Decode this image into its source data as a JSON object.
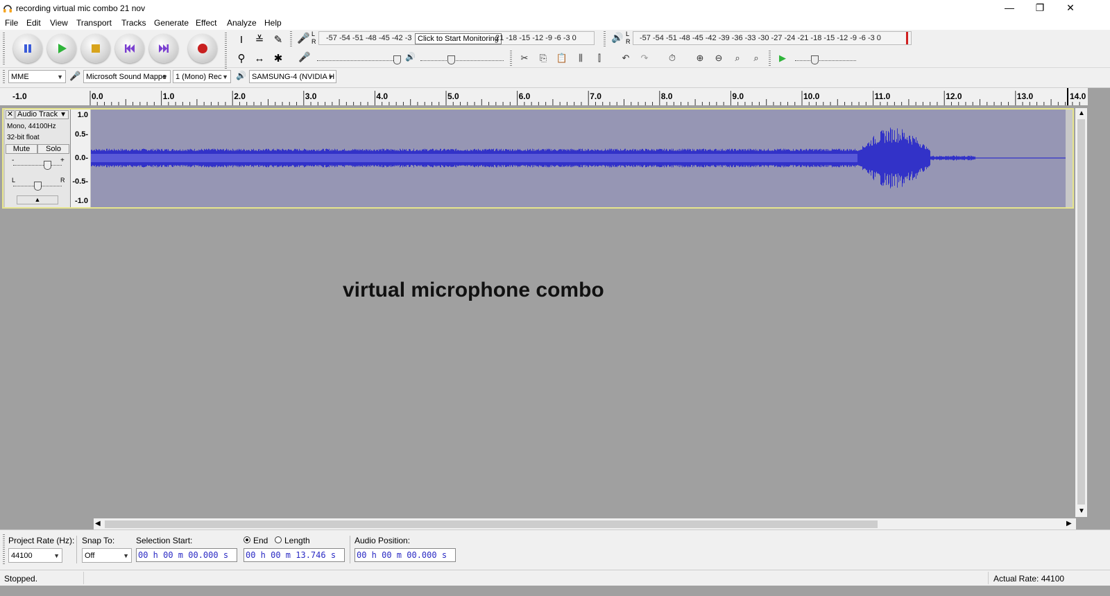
{
  "window": {
    "title": "recording virtual mic combo 21 nov",
    "minimize": "—",
    "maximize": "❐",
    "close": "✕"
  },
  "menu": [
    "File",
    "Edit",
    "View",
    "Transport",
    "Tracks",
    "Generate",
    "Effect",
    "Analyze",
    "Help"
  ],
  "meters": {
    "record_scale_left": "-57 -54 -51 -48 -45 -42 -3",
    "record_tooltip": "Click to Start Monitoring",
    "record_scale_right": "21 -18 -15 -12 -9 -6 -3 0",
    "play_scale": "-57 -54 -51 -48 -45 -42 -39 -36 -33 -30 -27 -24 -21 -18 -15 -12 -9 -6 -3 0",
    "L": "L",
    "R": "R"
  },
  "device": {
    "host": "MME",
    "input": "Microsoft Sound Mappe",
    "channels": "1 (Mono) Rec",
    "output": "SAMSUNG-4 (NVIDIA H"
  },
  "ruler": [
    "-1.0",
    "0.0",
    "1.0",
    "2.0",
    "3.0",
    "4.0",
    "5.0",
    "6.0",
    "7.0",
    "8.0",
    "9.0",
    "10.0",
    "11.0",
    "12.0",
    "13.0",
    "14.0"
  ],
  "track": {
    "name": "Audio Track",
    "format": "Mono, 44100Hz",
    "bitdepth": "32-bit float",
    "mute": "Mute",
    "solo": "Solo",
    "scale": [
      "1.0",
      "0.5-",
      "0.0-",
      "-0.5-",
      "-1.0"
    ]
  },
  "overlay_text": "virtual microphone combo",
  "selection": {
    "rate_label": "Project Rate (Hz):",
    "rate_value": "44100",
    "snap_label": "Snap To:",
    "snap_value": "Off",
    "start_label": "Selection Start:",
    "start_value": "00 h 00 m 00.000 s",
    "end_label": "End",
    "length_label": "Length",
    "end_value": "00 h 00 m 13.746 s",
    "pos_label": "Audio Position:",
    "pos_value": "00 h 00 m 00.000 s"
  },
  "status": {
    "state": "Stopped.",
    "rate": "Actual Rate: 44100"
  },
  "colors": {
    "waveform": "#3232c8",
    "waveform_bg": "#9696b4",
    "track_border": "#e7e58d"
  }
}
